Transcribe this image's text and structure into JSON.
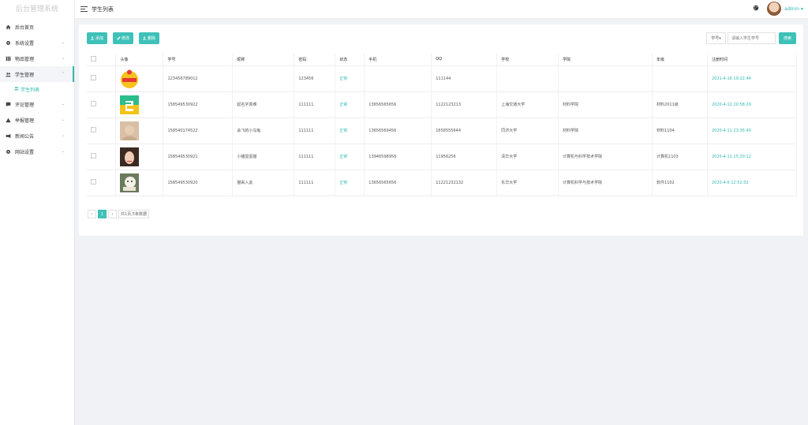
{
  "app": {
    "logo": "后台管理系统"
  },
  "sidebar": {
    "items": [
      {
        "label": "后台首页",
        "icon": "home-icon"
      },
      {
        "label": "系统设置",
        "icon": "gear-icon"
      },
      {
        "label": "物品管理",
        "icon": "goods-icon"
      },
      {
        "label": "学生管理",
        "icon": "users-icon"
      },
      {
        "label": "评论管理",
        "icon": "comment-icon"
      },
      {
        "label": "举报管理",
        "icon": "warning-icon"
      },
      {
        "label": "新闻公告",
        "icon": "news-icon"
      },
      {
        "label": "网站设置",
        "icon": "settings-icon"
      }
    ],
    "sub_item": {
      "label": "学生列表",
      "icon": "users-small-icon"
    }
  },
  "header": {
    "title": "学生列表",
    "user": "admin ▾"
  },
  "toolbar": {
    "add": "添加",
    "edit": "修改",
    "delete": "删除",
    "search_field": "学号▾",
    "search_placeholder": "请输入学生学号",
    "search_button": "搜索"
  },
  "table": {
    "columns": [
      "",
      "头像",
      "学号",
      "昵称",
      "密码",
      "状态",
      "手机",
      "QQ",
      "学校",
      "学院",
      "年级",
      "注册时间"
    ],
    "rows": [
      {
        "student_id": "123456789012",
        "nickname": "",
        "password": "123456",
        "status": "正常",
        "phone": "",
        "qq": "111144",
        "school": "",
        "college": "",
        "grade": "",
        "registered": "2021-4-16 19:22:44"
      },
      {
        "student_id": "158549530922",
        "nickname": "起名字真难",
        "password": "111111",
        "status": "正常",
        "phone": "13656565656",
        "qq": "1122123213",
        "school": "上海交通大学",
        "college": "材料学院",
        "grade": "材料2011级",
        "registered": "2020-4-12 20:58:29"
      },
      {
        "student_id": "158540174522",
        "nickname": "会飞的小乌龟",
        "password": "111111",
        "status": "正常",
        "phone": "13656569456",
        "qq": "1658555644",
        "school": "同济大学",
        "college": "材料学院",
        "grade": "材料1104",
        "registered": "2020-4-11 23:35:40"
      },
      {
        "student_id": "158549530921",
        "nickname": "小猪蛋蛋描",
        "password": "111111",
        "status": "正常",
        "phone": "13946598956",
        "qq": "11956256",
        "school": "清华大学",
        "college": "计算机与科学技术学院",
        "grade": "计算机1103",
        "registered": "2020-4-11 15:20:12"
      },
      {
        "student_id": "158549530920",
        "nickname": "猫来入此",
        "password": "111111",
        "status": "正常",
        "phone": "13656565656",
        "qq": "11221232132",
        "school": "东华大学",
        "college": "计算机科学与技术学院",
        "grade": "软件1102",
        "registered": "2020-4-6 12:52:02"
      }
    ]
  },
  "pagination": {
    "prev": "‹",
    "current": "1",
    "next": "›",
    "summary": "共1页,5条数据"
  },
  "colors": {
    "accent": "#3ec1b8",
    "date": "#2fb9b1"
  }
}
